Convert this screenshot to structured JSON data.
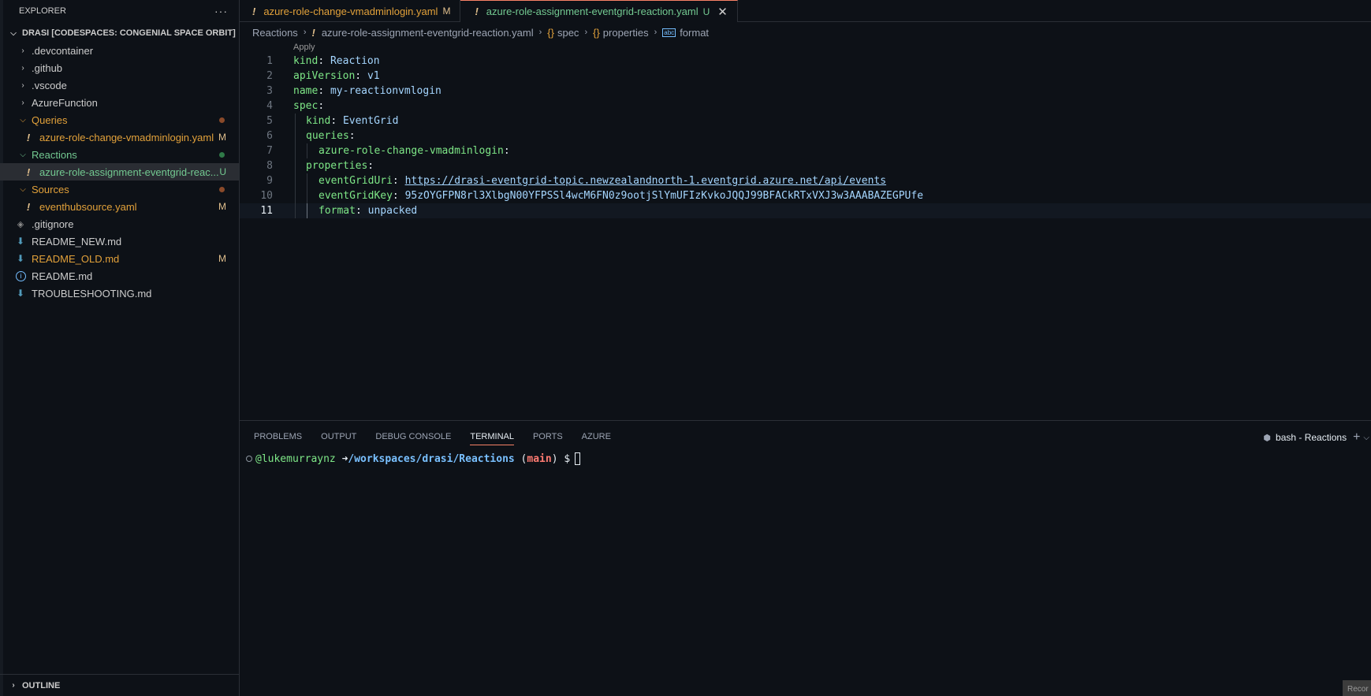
{
  "sidebar": {
    "title": "EXPLORER",
    "more": "···",
    "workspace": "DRASI [CODESPACES: CONGENIAL SPACE ORBIT]",
    "items": [
      {
        "label": ".devcontainer"
      },
      {
        "label": ".github"
      },
      {
        "label": ".vscode"
      },
      {
        "label": "AzureFunction"
      },
      {
        "label": "Queries"
      },
      {
        "label": "azure-role-change-vmadminlogin.yaml",
        "status": "M"
      },
      {
        "label": "Reactions"
      },
      {
        "label": "azure-role-assignment-eventgrid-reac...",
        "status": "U"
      },
      {
        "label": "Sources"
      },
      {
        "label": "eventhubsource.yaml",
        "status": "M"
      },
      {
        "label": ".gitignore"
      },
      {
        "label": "README_NEW.md"
      },
      {
        "label": "README_OLD.md",
        "status": "M"
      },
      {
        "label": "README.md"
      },
      {
        "label": "TROUBLESHOOTING.md"
      }
    ],
    "outline": "OUTLINE"
  },
  "tabs": [
    {
      "label": "azure-role-change-vmadminlogin.yaml",
      "badge": "M"
    },
    {
      "label": "azure-role-assignment-eventgrid-reaction.yaml",
      "badge": "U",
      "close": "✕"
    }
  ],
  "breadcrumb": {
    "folder": "Reactions",
    "file": "azure-role-assignment-eventgrid-reaction.yaml",
    "spec": "spec",
    "properties": "properties",
    "format": "format"
  },
  "editor": {
    "codelens": "Apply",
    "line_numbers": [
      "1",
      "2",
      "3",
      "4",
      "5",
      "6",
      "7",
      "8",
      "9",
      "10",
      "11"
    ],
    "lines": [
      {
        "key": "kind",
        "value": "Reaction"
      },
      {
        "key": "apiVersion",
        "value": "v1"
      },
      {
        "key": "name",
        "value": "my-reactionvmlogin"
      },
      {
        "key": "spec",
        "value": ""
      },
      {
        "key": "kind",
        "value": "EventGrid"
      },
      {
        "key": "queries",
        "value": ""
      },
      {
        "key": "azure-role-change-vmadminlogin",
        "value": ""
      },
      {
        "key": "properties",
        "value": ""
      },
      {
        "key": "eventGridUri",
        "value": "https://drasi-eventgrid-topic.newzealandnorth-1.eventgrid.azure.net/api/events"
      },
      {
        "key": "eventGridKey",
        "value": "95zOYGFPN8rl3XlbgN00YFPSSl4wcM6FN0z9ootjSlYmUFIzKvkoJQQJ99BFACkRTxVXJ3w3AAABAZEGPUfe"
      },
      {
        "key": "format",
        "value": "unpacked"
      }
    ]
  },
  "panel": {
    "tabs": [
      "PROBLEMS",
      "OUTPUT",
      "DEBUG CONSOLE",
      "TERMINAL",
      "PORTS",
      "AZURE"
    ],
    "terminal_name": "bash - Reactions",
    "prompt_user": "@lukemurraynz",
    "prompt_arrow": "➜",
    "prompt_path": "/workspaces/drasi/Reactions",
    "prompt_branch": "main",
    "prompt_dollar": "$"
  },
  "overlay": {
    "record": "Recor"
  },
  "colors": {
    "accent": "#f78166",
    "modified": "#e2c08d",
    "untracked": "#73c991",
    "folder_orange": "#e2a13a"
  }
}
